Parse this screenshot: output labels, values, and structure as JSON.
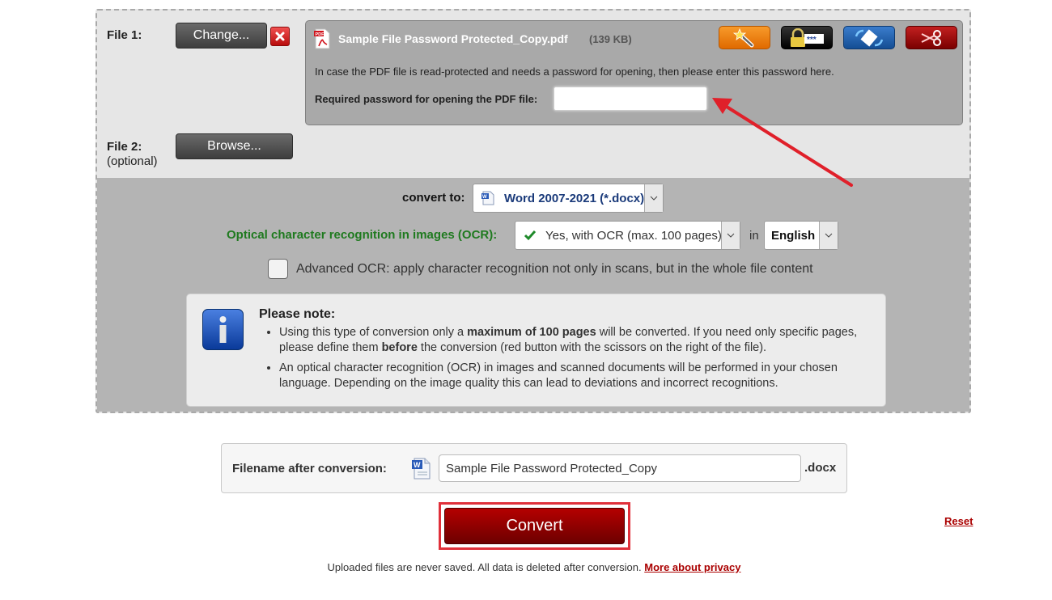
{
  "file1": {
    "label": "File 1:",
    "change_button": "Change...",
    "remove_icon": "close-icon",
    "file_name": "Sample File Password Protected_Copy.pdf",
    "file_size": "(139 KB)",
    "file_type_icon": "pdf-icon",
    "actions": [
      {
        "name": "magic-wand",
        "icon": "magic-wand-icon",
        "color": "#f07c0c"
      },
      {
        "name": "password",
        "icon": "lock-password-icon",
        "color": "#111111"
      },
      {
        "name": "rotate",
        "icon": "rotate-page-icon",
        "color": "#1d5ea8"
      },
      {
        "name": "split-scissors",
        "icon": "scissors-icon",
        "color": "#a30a0a"
      }
    ],
    "password_hint": "In case the PDF file is read-protected and needs a password for opening, then please enter this password here.",
    "password_label": "Required password for opening the PDF file:",
    "password_value": ""
  },
  "file2": {
    "label": "File 2:",
    "sublabel": "(optional)",
    "browse_button": "Browse..."
  },
  "convert_to": {
    "label": "convert to:",
    "selected": "Word 2007-2021 (*.docx)",
    "icon": "word-doc-icon"
  },
  "ocr": {
    "label": "Optical character recognition in images (OCR):",
    "selected": "Yes, with OCR (max. 100 pages)",
    "icon": "checkmark-icon",
    "in_label": "in",
    "language": "English"
  },
  "advanced_ocr": {
    "checked": false,
    "label": "Advanced OCR: apply character recognition not only in scans, but in the whole file content"
  },
  "note": {
    "title": "Please note:",
    "item1_pre": "Using this type of conversion only a ",
    "item1_bold": "maximum of 100 pages",
    "item1_mid": " will be converted. If you need only specific pages, please define them ",
    "item1_bold2": "before",
    "item1_post": " the conversion (red button with the scissors on the right of the file).",
    "item2": "An optical character recognition (OCR) in images and scanned documents will be performed in your chosen language. Depending on the image quality this can lead to deviations and incorrect recognitions."
  },
  "filename": {
    "label": "Filename after conversion:",
    "value": "Sample File Password Protected_Copy",
    "extension": ".docx"
  },
  "convert_button": "Convert",
  "reset_link": "Reset",
  "footer": {
    "text": "Uploaded files are never saved. All data is deleted after conversion. ",
    "link": "More about privacy"
  },
  "colors": {
    "accent_red": "#a00000",
    "ocr_green": "#1f7a1f",
    "select_blue": "#1a3a7a",
    "annotation_red": "#e0202a"
  }
}
